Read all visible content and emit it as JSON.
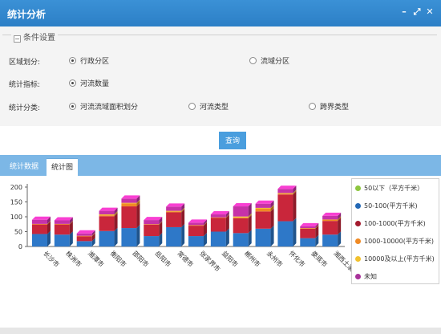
{
  "window": {
    "title": "统计分析"
  },
  "conditions": {
    "section_title": "条件设置",
    "region_label": "区域划分:",
    "region_options": [
      "行政分区",
      "流域分区"
    ],
    "indicator_label": "统计指标:",
    "indicator_options": [
      "河流数量"
    ],
    "category_label": "统计分类:",
    "category_options": [
      "河流流域面积划分",
      "河流类型",
      "跨界类型"
    ],
    "query_label": "查询"
  },
  "tabs": {
    "data": "统计数据",
    "chart": "统计图"
  },
  "legend": [
    {
      "label": "50以下（平方千米）",
      "color": "#8dc63f"
    },
    {
      "label": "50-100(平方千米)",
      "color": "#2368b5"
    },
    {
      "label": "100-1000(平方千米)",
      "color": "#a31a2d"
    },
    {
      "label": "1000-10000(平方千米)",
      "color": "#f08a24"
    },
    {
      "label": "10000及以上(平方千米)",
      "color": "#f2c12e"
    },
    {
      "label": "未知",
      "color": "#a8329a"
    }
  ],
  "chart_data": {
    "type": "bar",
    "stacked": true,
    "categories": [
      "长沙市",
      "株洲市",
      "湘潭市",
      "衡阳市",
      "邵阳市",
      "岳阳市",
      "常德市",
      "张家界市",
      "益阳市",
      "郴州市",
      "永州市",
      "怀化市",
      "娄底市",
      "湘西土家族苗族自治…"
    ],
    "series": [
      {
        "name": "50-100(平方千米)",
        "color": "#2e78c8",
        "values": [
          42,
          40,
          18,
          52,
          62,
          35,
          65,
          35,
          50,
          45,
          60,
          85,
          28,
          40
        ]
      },
      {
        "name": "100-1000(平方千米)",
        "color": "#c9263b",
        "values": [
          32,
          34,
          16,
          50,
          73,
          38,
          50,
          35,
          46,
          50,
          58,
          90,
          32,
          46
        ]
      },
      {
        "name": "1000-10000(平方千米)",
        "color": "#f08a24",
        "values": [
          2,
          2,
          2,
          3,
          10,
          2,
          3,
          2,
          2,
          3,
          10,
          3,
          2,
          5
        ]
      },
      {
        "name": "10000及以上(平方千米)",
        "color": "#f2c12e",
        "values": [
          0,
          0,
          0,
          3,
          2,
          0,
          2,
          0,
          0,
          3,
          2,
          2,
          0,
          0
        ]
      },
      {
        "name": "未知",
        "color": "#c632a8",
        "values": [
          14,
          12,
          8,
          12,
          14,
          14,
          14,
          8,
          10,
          34,
          14,
          14,
          6,
          12
        ]
      }
    ],
    "yticks": [
      0,
      50,
      100,
      150,
      200
    ],
    "ylim": [
      0,
      200
    ]
  }
}
